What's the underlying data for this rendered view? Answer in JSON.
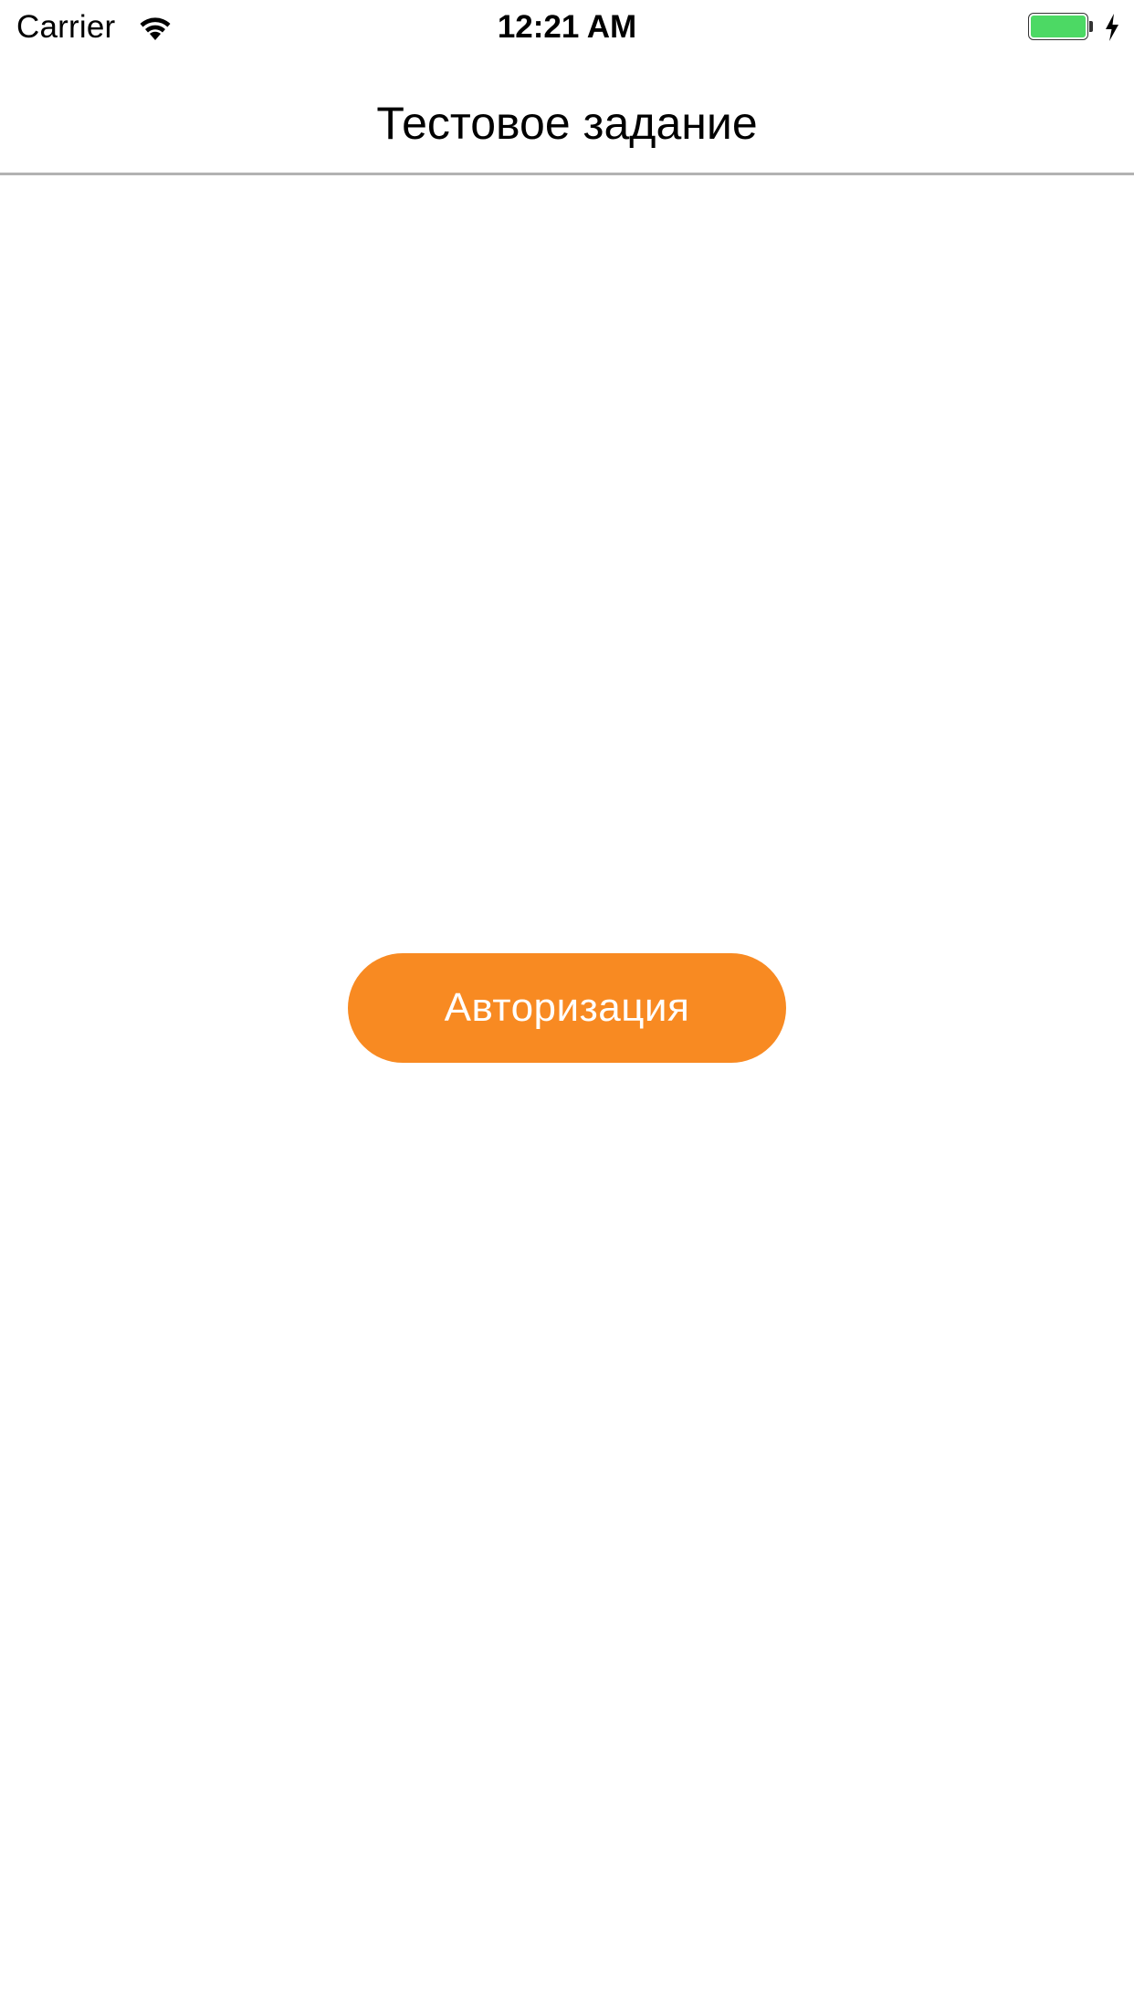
{
  "status_bar": {
    "carrier": "Carrier",
    "time": "12:21 AM",
    "wifi_icon": "wifi-icon",
    "battery_icon": "battery-icon",
    "charging_icon": "bolt-icon",
    "battery_level": 1.0,
    "battery_color": "#4cd964"
  },
  "nav_bar": {
    "title": "Тестовое задание"
  },
  "main": {
    "auth_button_label": "Авторизация",
    "accent_color": "#f88a22"
  }
}
